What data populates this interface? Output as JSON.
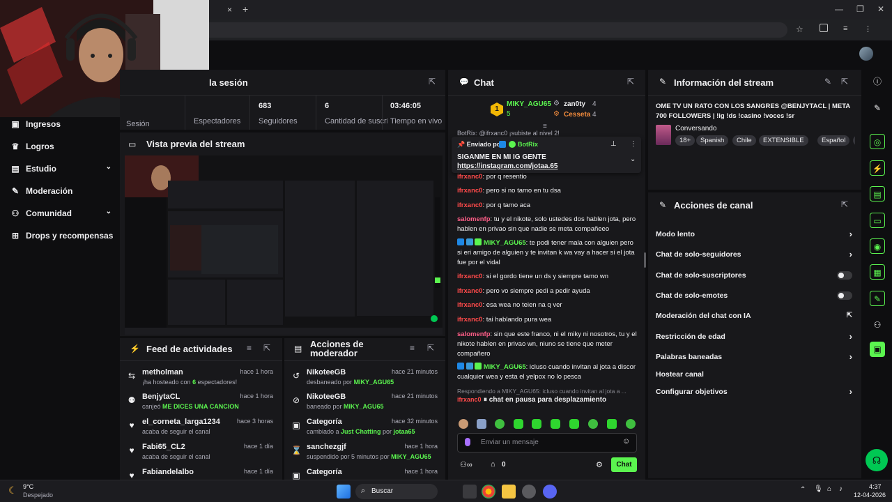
{
  "browser": {
    "tab_close": "×",
    "new_tab": "+",
    "min": "—",
    "max": "❐",
    "close": "✕"
  },
  "sidebar": {
    "items": [
      {
        "label": "Ingresos",
        "icon": "money-icon"
      },
      {
        "label": "Logros",
        "icon": "trophy-icon"
      },
      {
        "label": "Estudio",
        "icon": "studio-icon"
      },
      {
        "label": "Moderación",
        "icon": "wrench-icon"
      },
      {
        "label": "Comunidad",
        "icon": "community-icon"
      },
      {
        "label": "Drops y recompensas",
        "icon": "gift-icon"
      }
    ]
  },
  "session": {
    "title": "la sesión",
    "stats": [
      {
        "label": "Sesión",
        "value": ""
      },
      {
        "label": "Espectadores",
        "value": ""
      },
      {
        "label": "Seguidores",
        "value": "683"
      },
      {
        "label": "Cantidad de suscripciones",
        "value": "6"
      },
      {
        "label": "Tiempo en vivo",
        "value": "03:46:05"
      }
    ]
  },
  "preview": {
    "title": "Vista previa del stream"
  },
  "feed": {
    "title": "Feed de actividades",
    "rows": [
      {
        "name": "metholman",
        "desc_pre": "¡ha hosteado con ",
        "desc_hl": "6",
        "desc_post": " espectadores!",
        "time": "hace 1 hora"
      },
      {
        "name": "BenjytaCL",
        "desc_pre": "canjeó ",
        "desc_hl": "ME DICES UNA CANCION",
        "desc_post": "",
        "time": "hace 1 hora"
      },
      {
        "name": "el_corneta_larga1234",
        "desc_pre": "acaba de seguir el canal",
        "desc_hl": "",
        "desc_post": "",
        "time": "hace 3 horas"
      },
      {
        "name": "Fabi65_CL2",
        "desc_pre": "acaba de seguir el canal",
        "desc_hl": "",
        "desc_post": "",
        "time": "hace 1 día"
      },
      {
        "name": "Fabiandelalbo",
        "desc_pre": "",
        "desc_hl": "",
        "desc_post": "",
        "time": "hace 1 día"
      }
    ]
  },
  "modactions": {
    "title_1": "Acciones de",
    "title_2": "moderador",
    "rows": [
      {
        "name": "NikoteeGB",
        "desc_pre": "desbaneado por ",
        "desc_hl": "MIKY_AGU65",
        "desc_post": "",
        "time": "hace 21 minutos"
      },
      {
        "name": "NikoteeGB",
        "desc_pre": "baneado por ",
        "desc_hl": "MIKY_AGU65",
        "desc_post": "",
        "time": "hace 21 minutos"
      },
      {
        "name": "Categoría",
        "desc_pre": "cambiado a ",
        "desc_hl": "Just Chatting",
        "desc_post": " por ",
        "desc_hl2": "jotaa65",
        "time": "hace 32 minutos"
      },
      {
        "name": "sanchezgjf",
        "desc_pre": "suspendido por 5 minutos por ",
        "desc_hl": "MIKY_AGU65",
        "desc_post": "",
        "time": "hace 1 hora"
      },
      {
        "name": "Categoría",
        "desc_pre": "",
        "desc_hl": "",
        "desc_post": "",
        "time": "hace 1 hora"
      }
    ]
  },
  "chat": {
    "title": "Chat",
    "leaderboard": [
      {
        "rank": "1",
        "name": "MIKY_AGU65",
        "count": "5"
      },
      {
        "name": "zan0ty",
        "count": "4"
      },
      {
        "name": "Cesseta",
        "count": "4"
      }
    ],
    "pinned": {
      "sent_by_label": "Enviado por",
      "sent_by": "BotRix",
      "text": "SIGANME EN MI IG GENTE",
      "link": "https://instagram.com/jotaa.65"
    },
    "partial_top": "BotRix: @ifrxanc0 ¡subiste al nivel 2!",
    "messages": [
      {
        "user": "ifrxanc0",
        "color": "red",
        "text": "por q resentio"
      },
      {
        "user": "ifrxanc0",
        "color": "red",
        "text": "pero si no tamo en tu dsa"
      },
      {
        "user": "ifrxanc0",
        "color": "red",
        "text": "por q tamo aca"
      },
      {
        "user": "salomenfp",
        "color": "pink",
        "text": "tu y el nikote, solo ustedes dos hablen jota, pero hablen en privao sin que nadie se meta compañeeo"
      },
      {
        "user": "MIKY_AGU65",
        "color": "green",
        "text": "te podi tener mala con alguien pero si eri amigo de alguien y te invitan k wa vay a hacer si el jota fue por el vidal"
      },
      {
        "user": "ifrxanc0",
        "color": "red",
        "text": "si el gordo tiene un ds y siempre tamo wn"
      },
      {
        "user": "ifrxanc0",
        "color": "red",
        "text": "pero vo siempre pedi a pedir ayuda"
      },
      {
        "user": "ifrxanc0",
        "color": "red",
        "text": "esa wea no teien na q ver"
      },
      {
        "user": "ifrxanc0",
        "color": "red",
        "text": "tai hablando pura wea"
      },
      {
        "user": "salomenfp",
        "color": "pink",
        "text": "sin que este franco, ni el miky ni nosotros, tu y el nikote hablen en privao wn, niuno se tiene que meter compañero"
      },
      {
        "user": "MIKY_AGU65",
        "color": "green",
        "text": "icluso cuando invitan al jota a discor cualquier wea y esta el yelpox no lo pesca"
      }
    ],
    "reply_preview": "Respondiendo a MIKY_AGU65: icluso cuando invitan al jota a ...",
    "reply_user": "ifrxanc0",
    "paused": "chat en pausa para desplazamiento",
    "input_placeholder": "Enviar un mensaje",
    "points": "0",
    "send": "Chat"
  },
  "streaminfo": {
    "title": "Información del stream",
    "stream_title": "OME TV UN RATO CON LOS SANGRES @BENJYTACL | META 700 FOLLOWERS | !ig !ds !casino !voces !sr",
    "category": "Conversando",
    "tags": [
      "18+",
      "Spanish",
      "Chile",
      "EXTENSIBLE",
      "Español",
      "c"
    ]
  },
  "channelactions": {
    "title": "Acciones de canal",
    "items": [
      {
        "label": "Modo lento",
        "kind": "chevron"
      },
      {
        "label": "Chat de solo-seguidores",
        "kind": "chevron"
      },
      {
        "label": "Chat de solo-suscriptores",
        "kind": "toggle"
      },
      {
        "label": "Chat de solo-emotes",
        "kind": "toggle"
      },
      {
        "label": "Moderación del chat con IA",
        "kind": "external"
      },
      {
        "label": "Restricción de edad",
        "kind": "chevron"
      },
      {
        "label": "Palabras baneadas",
        "kind": "chevron"
      },
      {
        "label": "Hostear canal",
        "kind": "none"
      },
      {
        "label": "Configurar objetivos",
        "kind": "chevron"
      }
    ]
  },
  "taskbar": {
    "temp": "9°C",
    "weather": "Despejado",
    "search": "Buscar",
    "time": "4:37",
    "date": "12-04-2026"
  },
  "colors": {
    "accent": "#5bf44f",
    "panel": "#18181b",
    "bg": "#0e0e10",
    "red_user": "#ff4a4a",
    "pink_user": "#ff5e88"
  }
}
